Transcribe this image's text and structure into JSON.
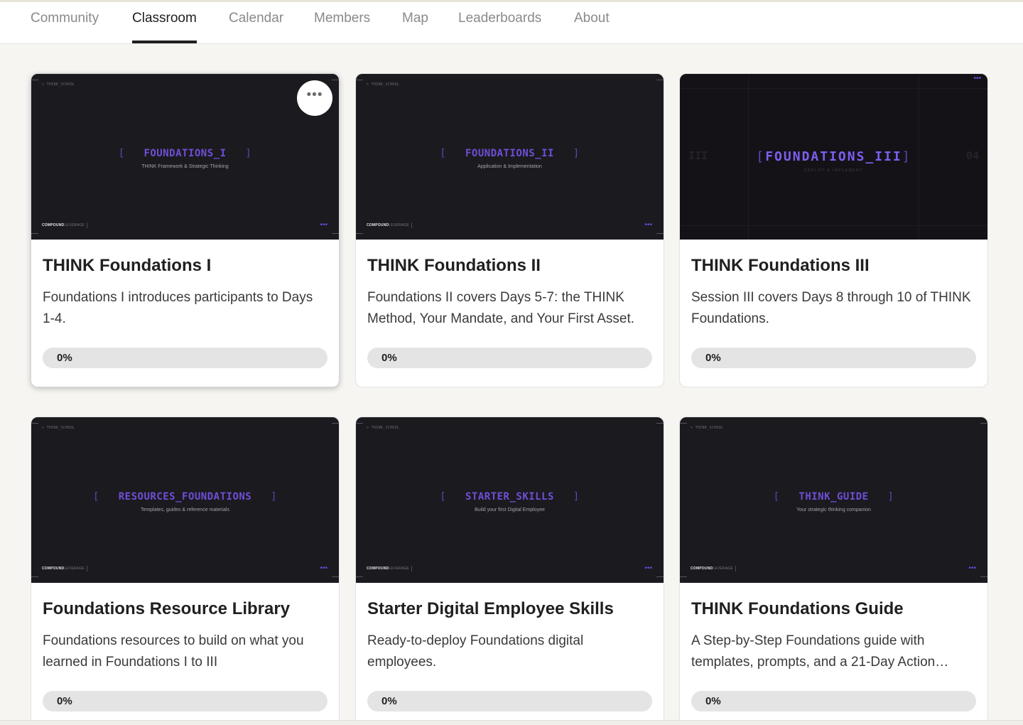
{
  "nav": {
    "tabs": [
      {
        "label": "Community",
        "active": false
      },
      {
        "label": "Classroom",
        "active": true
      },
      {
        "label": "Calendar",
        "active": false
      },
      {
        "label": "Members",
        "active": false
      },
      {
        "label": "Map",
        "active": false
      },
      {
        "label": "Leaderboards",
        "active": false
      },
      {
        "label": "About",
        "active": false
      }
    ]
  },
  "courses": [
    {
      "title": "THINK Foundations I",
      "description": "Foundations I introduces participants to Days 1-4.",
      "progress_percent": 0,
      "progress_label": "0%",
      "thumb": {
        "crumb": "> THINK_SCHOOL",
        "code": "FOUNDATIONS_I",
        "subtitle": "THINK Framework & Strategic Thinking",
        "brand_bold": "COMPOUND",
        "brand_light": "LEVERAGE"
      },
      "more_label": "•••"
    },
    {
      "title": "THINK Foundations II",
      "description": "Foundations II covers Days 5-7: the THINK Method, Your Mandate, and Your First Asset.",
      "progress_percent": 0,
      "progress_label": "0%",
      "thumb": {
        "crumb": "> THINK_SCHOOL",
        "code": "FOUNDATIONS_II",
        "subtitle": "Application & Implementation",
        "brand_bold": "COMPOUND",
        "brand_light": "LEVERAGE"
      }
    },
    {
      "title": "THINK Foundations III",
      "description": "Session III covers Days 8 through 10 of THINK Foundations.",
      "progress_percent": 0,
      "progress_label": "0%",
      "thumb": {
        "code": "FOUNDATIONS_III",
        "subtitle": "DEPLOY & IMPLEMENT",
        "left_num": "III",
        "right_num": "04"
      }
    },
    {
      "title": "Foundations Resource Library",
      "description": "Foundations resources to build on what you learned in Foundations I to III",
      "progress_percent": 0,
      "progress_label": "0%",
      "thumb": {
        "crumb": "> THINK_SCHOOL",
        "code": "RESOURCES_FOUNDATIONS",
        "subtitle": "Templates, guides & reference materials",
        "brand_bold": "COMPOUND",
        "brand_light": "LEVERAGE"
      }
    },
    {
      "title": "Starter Digital Employee Skills",
      "description": "Ready-to-deploy Foundations digital employees.",
      "progress_percent": 0,
      "progress_label": "0%",
      "thumb": {
        "crumb": "> THINK_SCHOOL",
        "code": "STARTER_SKILLS",
        "subtitle": "Build your first Digital Employee",
        "brand_bold": "COMPOUND",
        "brand_light": "LEVERAGE"
      }
    },
    {
      "title": "THINK Foundations Guide",
      "description": "A Step-by-Step Foundations guide with templates, prompts, and a 21-Day Action…",
      "progress_percent": 0,
      "progress_label": "0%",
      "thumb": {
        "crumb": "> THINK_SCHOOL",
        "code": "THINK_GUIDE",
        "subtitle": "Your strategic thinking companion",
        "brand_bold": "COMPOUND",
        "brand_light": "LEVERAGE"
      }
    }
  ],
  "colors": {
    "accent_purple": "#6f4fd6",
    "thumb_bg": "#1b1a1f",
    "progress_track": "#e4e4e4",
    "nav_active": "#1f1f1f"
  }
}
